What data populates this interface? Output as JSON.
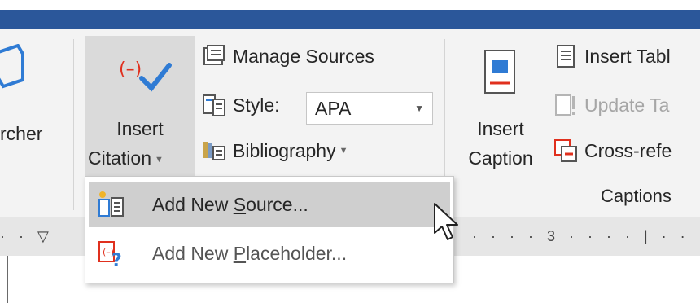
{
  "colors": {
    "title_bar": "#2b579a",
    "ribbon_bg": "#f3f3f3",
    "hover_bg": "#dadada",
    "menu_hover": "#cfcfcf",
    "accent_red": "#e0301e",
    "accent_blue": "#2f7bd4"
  },
  "ribbon": {
    "partial_left_label": "rcher",
    "insert_citation": {
      "line1": "Insert",
      "line2": "Citation",
      "icon": "insert-citation-icon"
    },
    "manage_sources": {
      "label": "Manage Sources",
      "icon": "manage-sources-icon"
    },
    "style": {
      "label": "Style:",
      "value": "APA",
      "icon": "style-icon"
    },
    "bibliography": {
      "label": "Bibliography",
      "icon": "bibliography-icon"
    },
    "insert_caption": {
      "line1": "Insert",
      "line2": "Caption",
      "icon": "insert-caption-icon"
    },
    "insert_table": {
      "label": "Insert Tabl",
      "icon": "insert-table-icon"
    },
    "update_table": {
      "label": "Update Ta",
      "icon": "update-table-icon"
    },
    "cross_ref": {
      "label": "Cross-refe",
      "icon": "cross-reference-icon"
    },
    "captions_group": "Captions"
  },
  "ruler": {
    "left_marks": "· · ▽",
    "right_marks": "· · · · 3 · · · · | · · ·"
  },
  "menu": {
    "items": [
      {
        "pre": "Add New ",
        "mnemonic": "S",
        "post": "ource...",
        "icon": "add-source-icon"
      },
      {
        "pre": "Add New ",
        "mnemonic": "P",
        "post": "laceholder...",
        "icon": "add-placeholder-icon"
      }
    ]
  }
}
